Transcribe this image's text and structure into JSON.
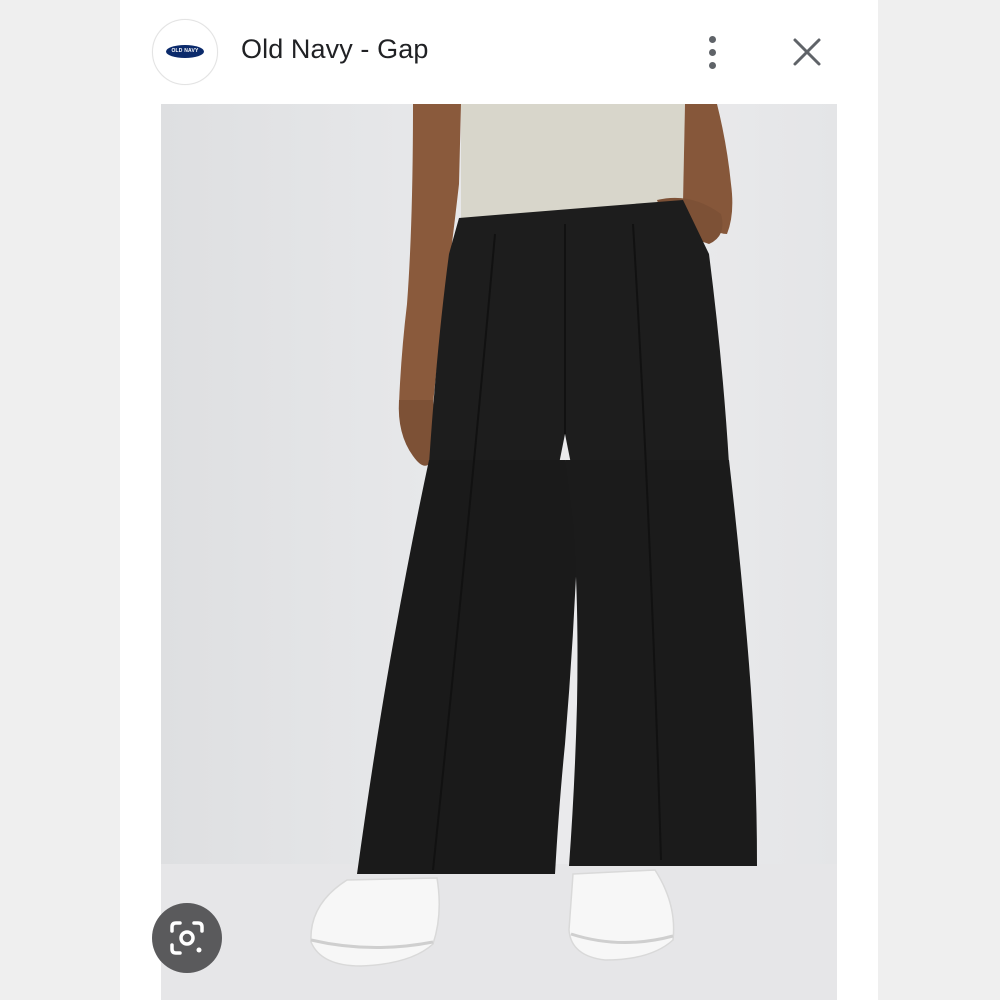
{
  "header": {
    "title": "Old Navy - Gap",
    "logo_text": "OLD NAVY",
    "more_icon": "more-vert-icon",
    "close_icon": "close-icon"
  },
  "image": {
    "subject": "black wide-leg pants with white sneakers"
  },
  "actions": {
    "lens_icon": "google-lens-icon"
  },
  "colors": {
    "brand_navy": "#0b2a6b",
    "pants": "#1c1c1c",
    "lens_button": "#5a5a5c"
  }
}
